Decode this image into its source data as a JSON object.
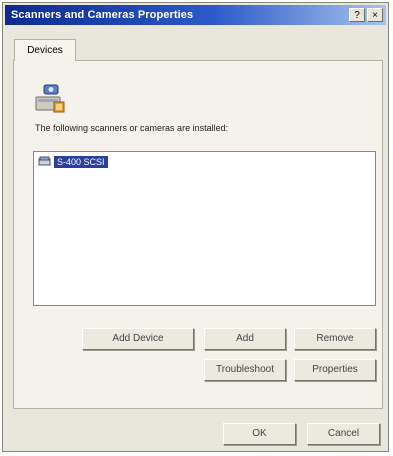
{
  "window": {
    "title": "Scanners and Cameras Properties"
  },
  "titlebar": {
    "help_glyph": "?",
    "close_glyph": "×"
  },
  "tabs": [
    {
      "label": "Devices"
    }
  ],
  "devices": {
    "description": "The following scanners or cameras are installed:",
    "items": [
      {
        "label": "S-400 SCSI",
        "selected": true,
        "icon": "scanner-icon"
      }
    ]
  },
  "buttons": {
    "add_device": "Add Device",
    "add": "Add",
    "remove": "Remove",
    "troubleshoot": "Troubleshoot",
    "properties": "Properties"
  },
  "footer": {
    "ok": "OK",
    "cancel": "Cancel"
  }
}
